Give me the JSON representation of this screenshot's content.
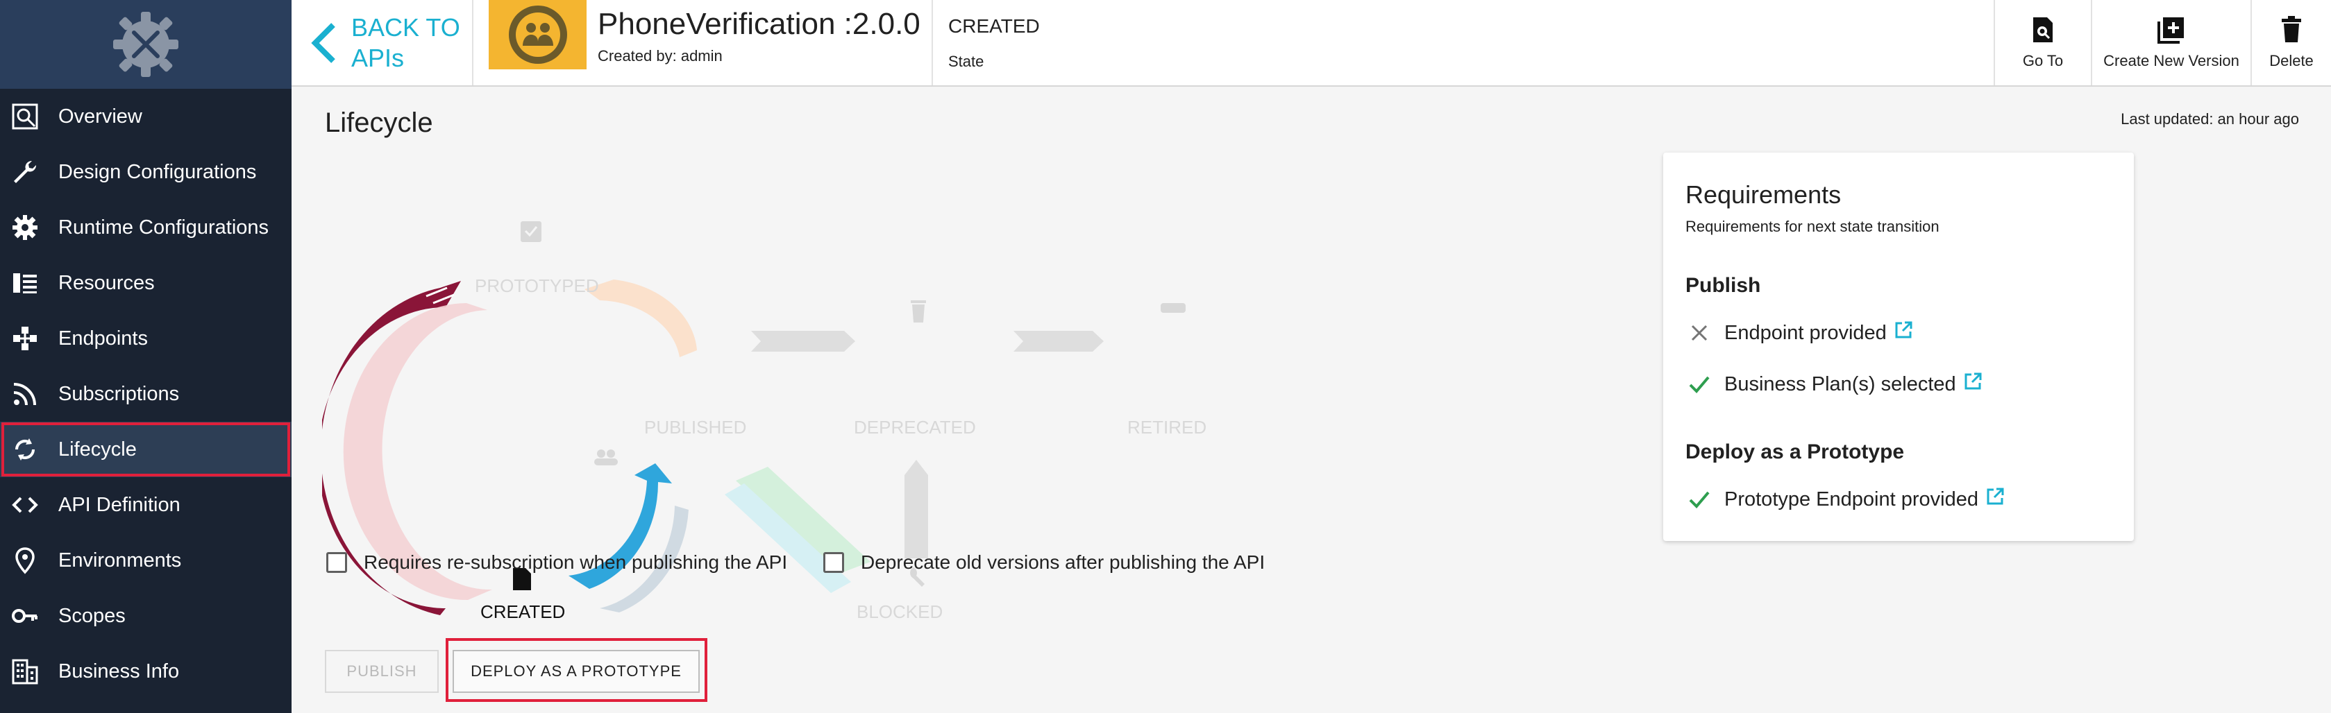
{
  "header": {
    "back_label_line1": "BACK TO",
    "back_label_line2": "APIs",
    "api_name": "PhoneVerification :2.0.0",
    "created_by": "Created by: admin",
    "state_value": "CREATED",
    "state_label": "State",
    "actions": [
      {
        "label": "Go To",
        "icon": "search-doc-icon"
      },
      {
        "label": "Create New Version",
        "icon": "add-box-icon"
      },
      {
        "label": "Delete",
        "icon": "trash-icon"
      }
    ]
  },
  "sidebar": {
    "items": [
      {
        "label": "Overview",
        "icon": "overview-icon"
      },
      {
        "label": "Design Configurations",
        "icon": "wrench-icon"
      },
      {
        "label": "Runtime Configurations",
        "icon": "gear-icon"
      },
      {
        "label": "Resources",
        "icon": "resources-icon"
      },
      {
        "label": "Endpoints",
        "icon": "endpoints-icon"
      },
      {
        "label": "Subscriptions",
        "icon": "rss-icon"
      },
      {
        "label": "Lifecycle",
        "icon": "sync-icon",
        "active": true
      },
      {
        "label": "API Definition",
        "icon": "code-icon"
      },
      {
        "label": "Environments",
        "icon": "location-icon"
      },
      {
        "label": "Scopes",
        "icon": "key-icon"
      },
      {
        "label": "Business Info",
        "icon": "building-icon"
      }
    ]
  },
  "main": {
    "title": "Lifecycle",
    "last_updated": "Last updated: an hour ago",
    "states": {
      "prototyped": "PROTOTYPED",
      "published": "PUBLISHED",
      "deprecated": "DEPRECATED",
      "retired": "RETIRED",
      "created": "CREATED",
      "blocked": "BLOCKED"
    },
    "current_state": "CREATED",
    "checkboxes": [
      {
        "label": "Requires re-subscription when publishing the API",
        "checked": false
      },
      {
        "label": "Deprecate old versions after publishing the API",
        "checked": false
      }
    ],
    "buttons": {
      "publish": "PUBLISH",
      "deploy_prototype": "DEPLOY AS A PROTOTYPE"
    }
  },
  "requirements": {
    "title": "Requirements",
    "subtitle": "Requirements for next state transition",
    "sections": [
      {
        "heading": "Publish",
        "items": [
          {
            "label": "Endpoint provided",
            "met": false
          },
          {
            "label": "Business Plan(s) selected",
            "met": true
          }
        ]
      },
      {
        "heading": "Deploy as a Prototype",
        "items": [
          {
            "label": "Prototype Endpoint provided",
            "met": true
          }
        ]
      }
    ]
  },
  "colors": {
    "sidebar_bg": "#1a2332",
    "accent": "#1ab0d0",
    "highlight": "#e0203b",
    "created_arc": "#8a1538",
    "publish_arrow": "#2fa6dc",
    "check_green": "#2e9e4f",
    "thumb_bg": "#f4b530"
  }
}
